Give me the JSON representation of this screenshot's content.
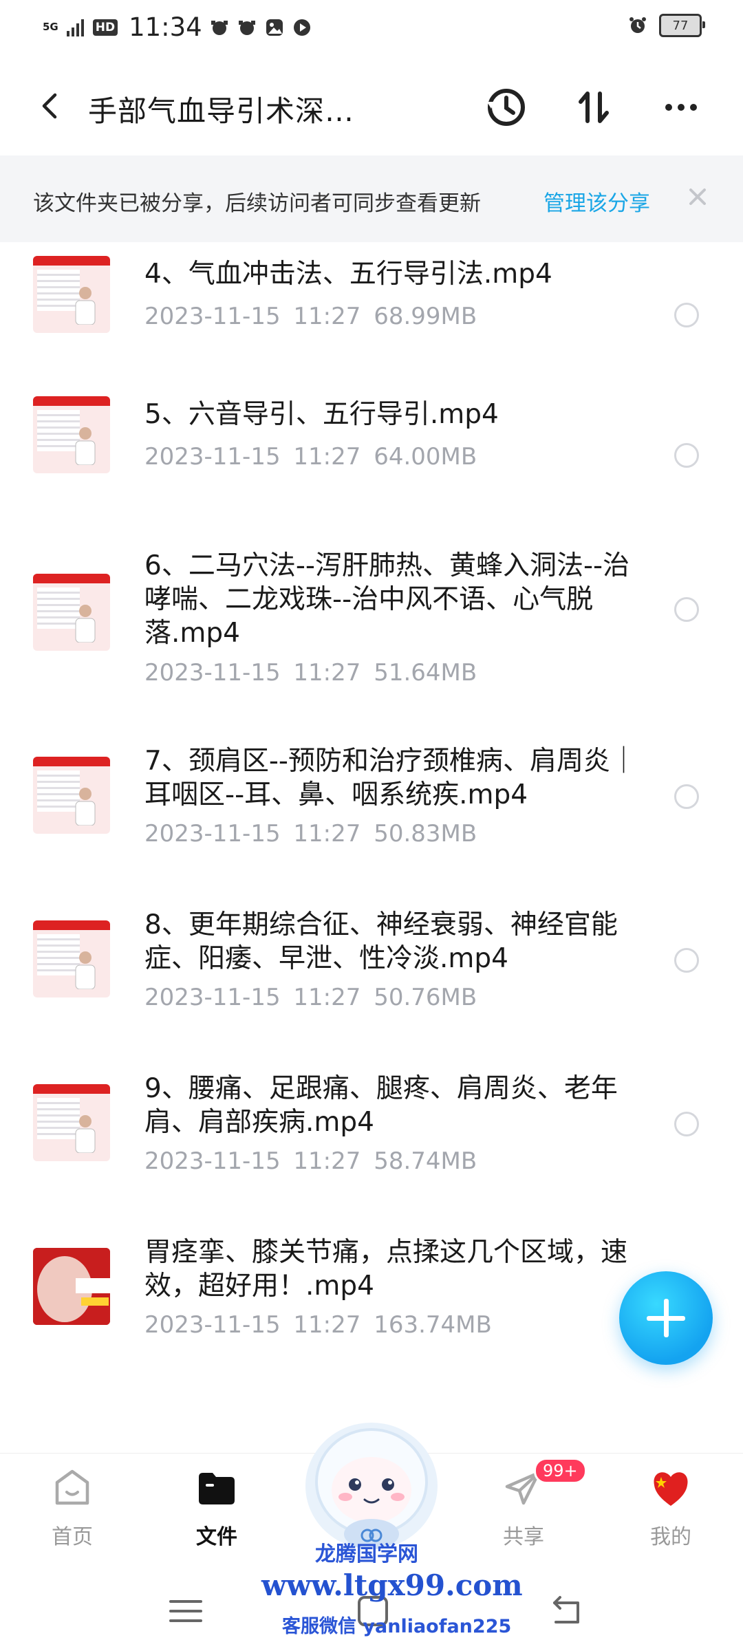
{
  "status_bar": {
    "network": "5G",
    "hd": "HD",
    "time": "11:34",
    "battery": "77"
  },
  "header": {
    "title": "手部气血导引术深…"
  },
  "share_notice": {
    "text": "该文件夹已被分享，后续访问者可同步查看更新",
    "manage_link": "管理该分享"
  },
  "files": [
    {
      "name": "4、气血冲击法、五行导引法.mp4",
      "date": "2023-11-15",
      "time": "11:27",
      "size": "68.99MB"
    },
    {
      "name": "5、六音导引、五行导引.mp4",
      "date": "2023-11-15",
      "time": "11:27",
      "size": "64.00MB"
    },
    {
      "name": "6、二马穴法--泻肝肺热、黄蜂入洞法--治哮喘、二龙戏珠--治中风不语、心气脱落.mp4",
      "date": "2023-11-15",
      "time": "11:27",
      "size": "51.64MB"
    },
    {
      "name": "7、颈肩区--预防和治疗颈椎病、肩周炎｜耳咽区--耳、鼻、咽系统疾.mp4",
      "date": "2023-11-15",
      "time": "11:27",
      "size": "50.83MB"
    },
    {
      "name": "8、更年期综合征、神经衰弱、神经官能症、阳痿、早泄、性冷淡.mp4",
      "date": "2023-11-15",
      "time": "11:27",
      "size": "50.76MB"
    },
    {
      "name": "9、腰痛、足跟痛、腿疼、肩周炎、老年肩、肩部疾病.mp4",
      "date": "2023-11-15",
      "time": "11:27",
      "size": "58.74MB"
    },
    {
      "name": "胃痉挛、膝关节痛，点揉这几个区域，速效，超好用！.mp4",
      "date": "2023-11-15",
      "time": "11:27",
      "size": "163.74MB"
    }
  ],
  "bottom_nav": {
    "home": "首页",
    "files": "文件",
    "share": "共享",
    "share_badge": "99+",
    "me": "我的"
  },
  "watermark": {
    "line1": "龙腾国学网",
    "line2": "www.ltgx99.com",
    "line3": "客服微信 yanliaofan225"
  },
  "colors": {
    "accent": "#1aa6e6",
    "badge": "#ff3a5c",
    "meta_text": "#a3a6ad"
  }
}
